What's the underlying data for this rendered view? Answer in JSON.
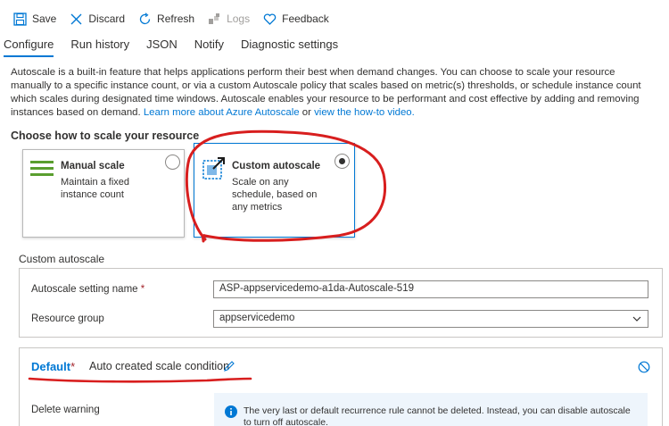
{
  "toolbar": {
    "save": "Save",
    "discard": "Discard",
    "refresh": "Refresh",
    "logs": "Logs",
    "feedback": "Feedback"
  },
  "tabs": [
    {
      "label": "Configure",
      "active": true
    },
    {
      "label": "Run history"
    },
    {
      "label": "JSON"
    },
    {
      "label": "Notify"
    },
    {
      "label": "Diagnostic settings"
    }
  ],
  "description": {
    "text": "Autoscale is a built-in feature that helps applications perform their best when demand changes. You can choose to scale your resource manually to a specific instance count, or via a custom Autoscale policy that scales based on metric(s) thresholds, or schedule instance count which scales during designated time windows. Autoscale enables your resource to be performant and cost effective by adding and removing instances based on demand.",
    "link1": "Learn more about Azure Autoscale",
    "or": "or",
    "link2": "view the how-to video."
  },
  "choose_title": "Choose how to scale your resource",
  "options": {
    "manual": {
      "title": "Manual scale",
      "subtitle": "Maintain a fixed instance count",
      "selected": false
    },
    "custom": {
      "title": "Custom autoscale",
      "subtitle": "Scale on any schedule, based on any metrics",
      "selected": true
    }
  },
  "section_label": "Custom autoscale",
  "form": {
    "setting_name_label": "Autoscale setting name",
    "setting_name_required": "*",
    "setting_name_value": "ASP-appservicedemo-a1da-Autoscale-519",
    "resource_group_label": "Resource group",
    "resource_group_value": "appservicedemo"
  },
  "condition": {
    "name": "Default",
    "required": "*",
    "text": "Auto created scale condition",
    "delete_warning_label": "Delete warning",
    "info_text": "The very last or default recurrence rule cannot be deleted. Instead, you can disable autoscale to turn off autoscale."
  },
  "colors": {
    "accent": "#0078d4",
    "annotation": "#d81e1e",
    "required": "#a4262c",
    "info_bg": "#eef5fc"
  }
}
